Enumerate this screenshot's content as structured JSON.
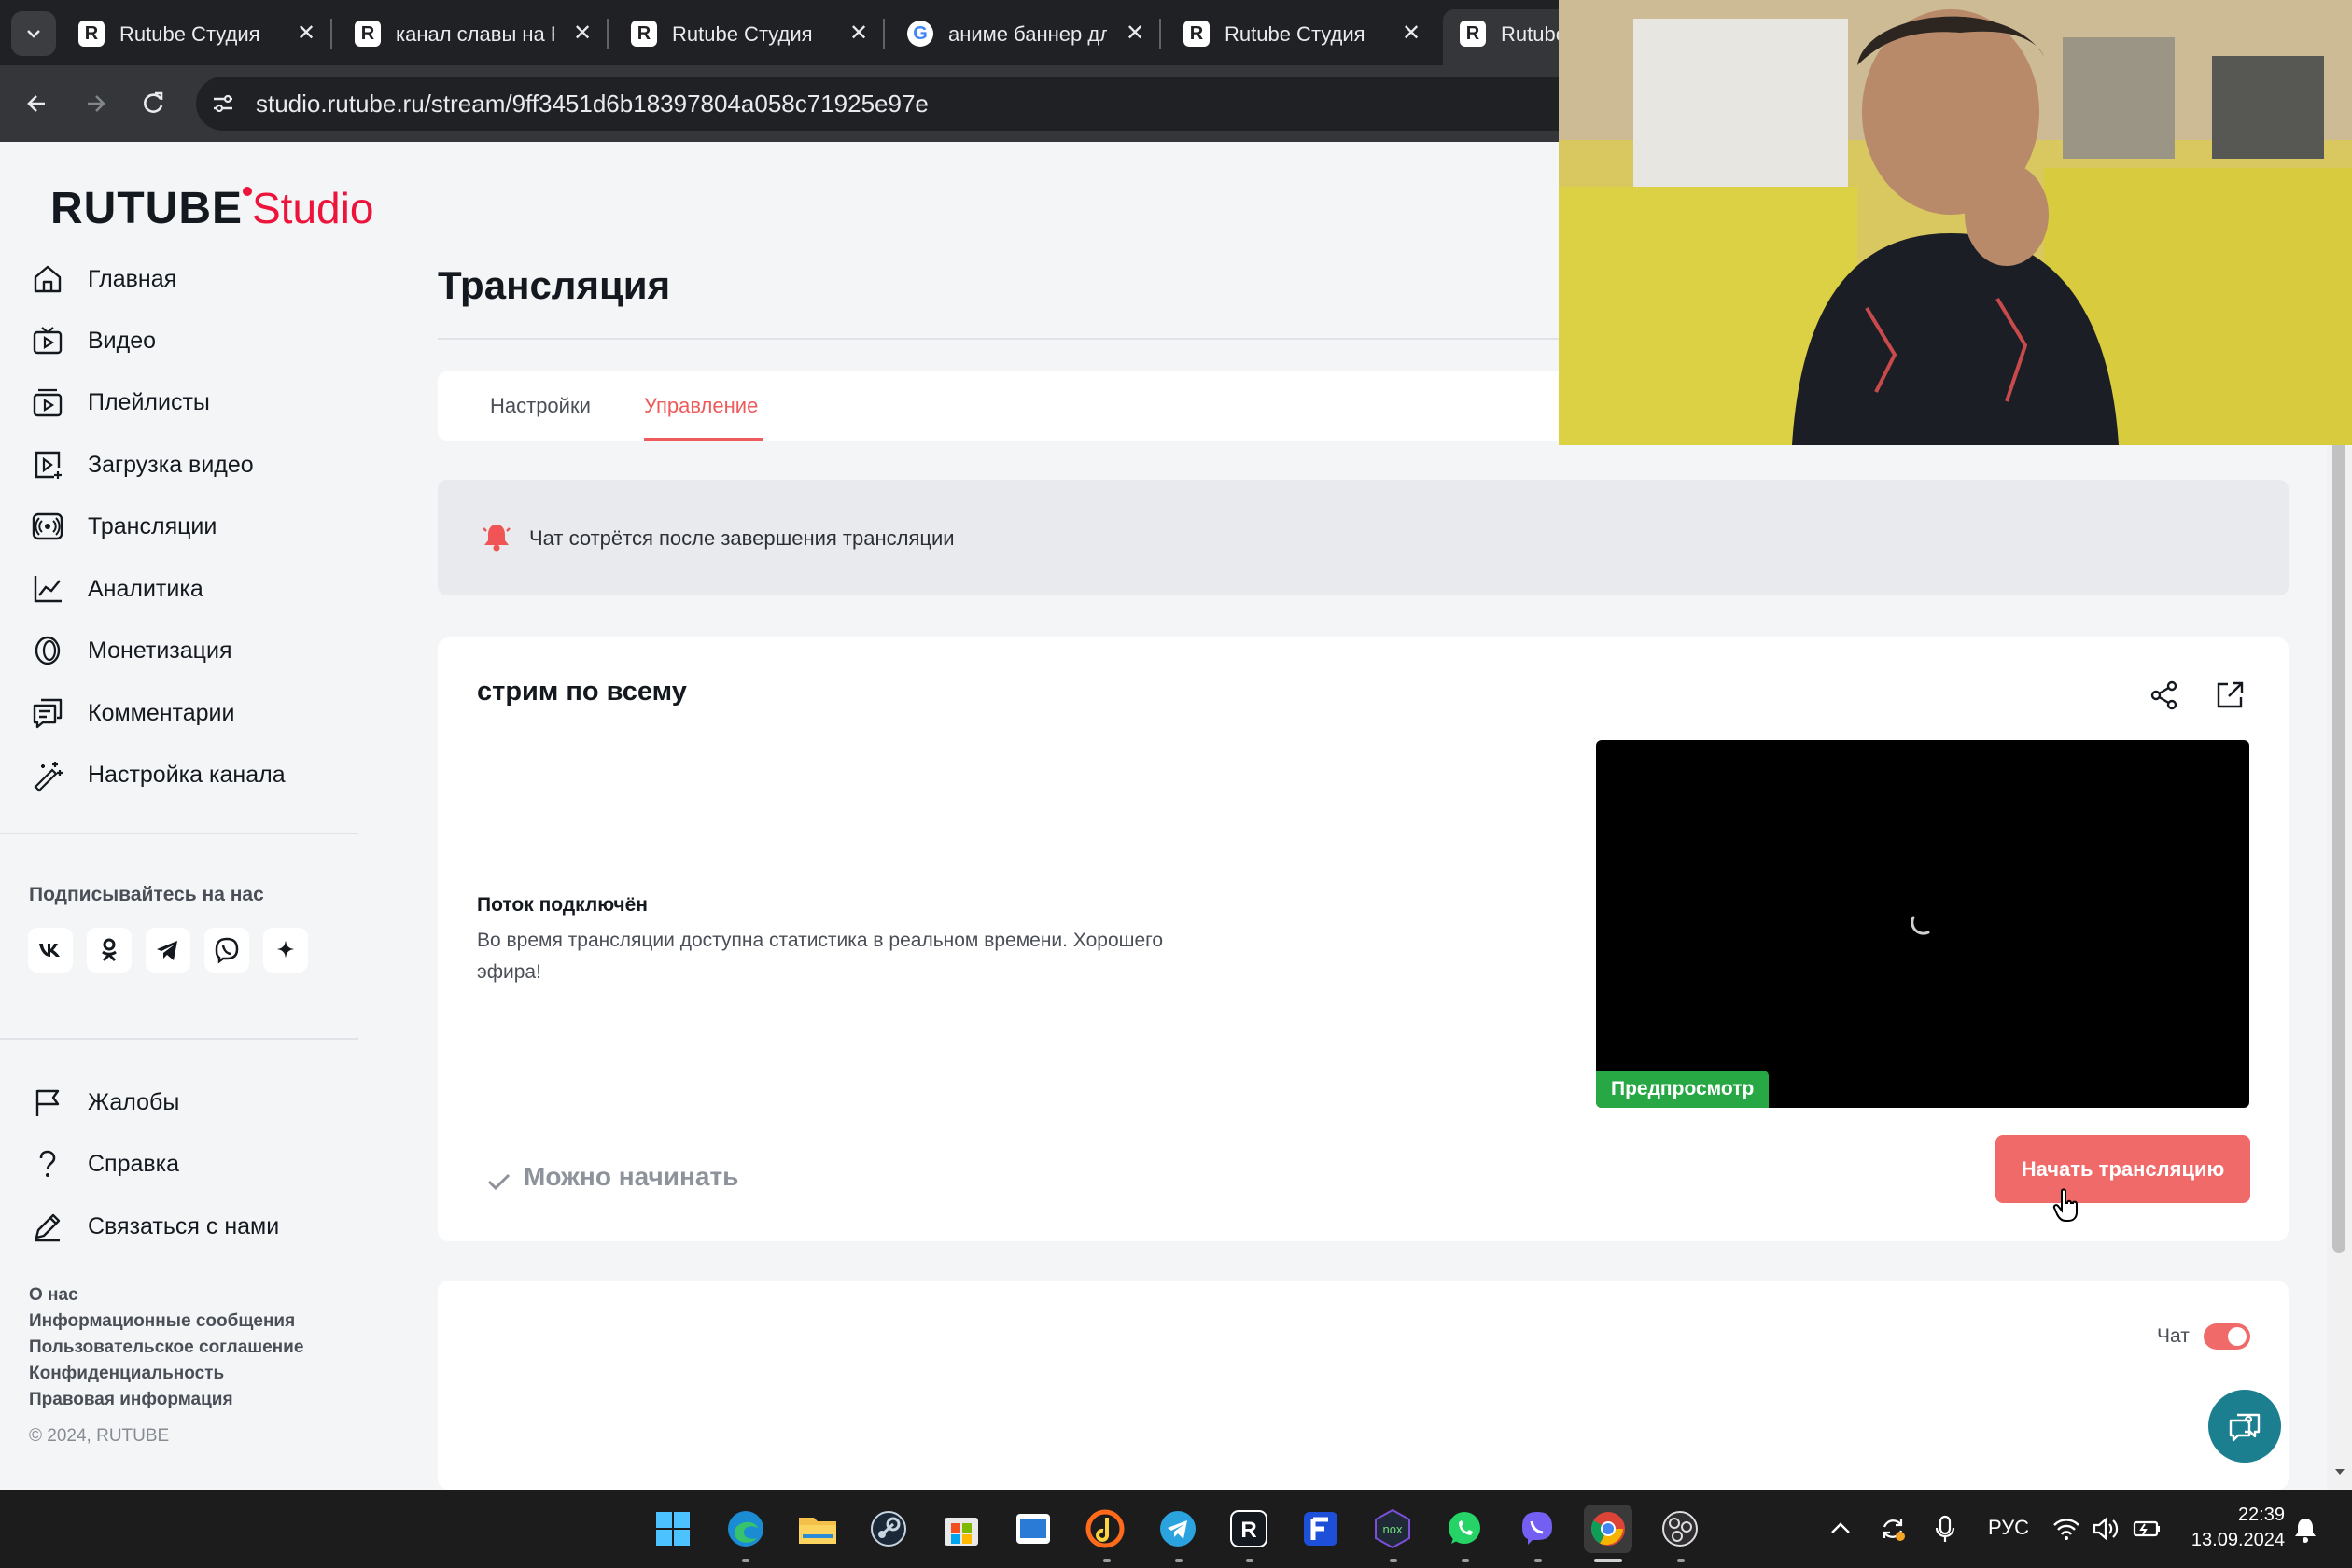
{
  "browser": {
    "tabs": [
      {
        "title": "Rutube Студия",
        "favicon": "R"
      },
      {
        "title": "канал славы на Rutube",
        "favicon": "R"
      },
      {
        "title": "Rutube Студия",
        "favicon": "R"
      },
      {
        "title": "аниме баннер для канала",
        "favicon": "G"
      },
      {
        "title": "Rutube Студия",
        "favicon": "R"
      },
      {
        "title": "Rutube",
        "favicon": "R"
      }
    ],
    "url": "studio.rutube.ru/stream/9ff3451d6b18397804a058c71925e97e"
  },
  "logo": {
    "brand": "RUTUBE",
    "product": "Studio"
  },
  "sidebar": {
    "items": [
      {
        "label": "Главная",
        "icon": "home-icon"
      },
      {
        "label": "Видео",
        "icon": "video-icon"
      },
      {
        "label": "Плейлисты",
        "icon": "playlist-icon"
      },
      {
        "label": "Загрузка видео",
        "icon": "upload-icon"
      },
      {
        "label": "Трансляции",
        "icon": "broadcast-icon"
      },
      {
        "label": "Аналитика",
        "icon": "analytics-icon"
      },
      {
        "label": "Монетизация",
        "icon": "coin-icon"
      },
      {
        "label": "Комментарии",
        "icon": "comments-icon"
      },
      {
        "label": "Настройка канала",
        "icon": "magic-wand-icon"
      }
    ],
    "follow_title": "Подписывайтесь на нас",
    "socials": [
      {
        "name": "vk-icon",
        "glyph": "vk"
      },
      {
        "name": "ok-icon",
        "glyph": "ok"
      },
      {
        "name": "telegram-icon",
        "glyph": "tg"
      },
      {
        "name": "viber-icon",
        "glyph": "vb"
      },
      {
        "name": "sparkle-icon",
        "glyph": "✦"
      }
    ],
    "bottom_items": [
      {
        "label": "Жалобы",
        "icon": "flag-icon"
      },
      {
        "label": "Справка",
        "icon": "help-icon"
      },
      {
        "label": "Связаться с нами",
        "icon": "pen-icon"
      }
    ],
    "footer_links": [
      "О нас",
      "Информационные сообщения",
      "Пользовательское соглашение",
      "Конфиденциальность",
      "Правовая информация"
    ],
    "copyright": "© 2024, RUTUBE"
  },
  "main": {
    "title": "Трансляция",
    "tabs": [
      {
        "label": "Настройки",
        "active": false
      },
      {
        "label": "Управление",
        "active": true
      }
    ],
    "notice": "Чат сотрётся после завершения трансляции",
    "stream": {
      "name": "стрим по всему",
      "status_title": "Поток подключён",
      "status_desc": "Во время трансляции доступна статистика в реальном времени. Хорошего эфира!",
      "preview_badge": "Предпросмотр",
      "ready_label": "Можно начинать",
      "start_button": "Начать трансляцию"
    },
    "chat": {
      "label": "Чат",
      "enabled": true
    }
  },
  "taskbar": {
    "language": "РУС",
    "time": "22:39",
    "date": "13.09.2024"
  },
  "colors": {
    "accent": "#f06a6a",
    "brand_red": "#ed143b",
    "preview_badge": "#27a844"
  }
}
